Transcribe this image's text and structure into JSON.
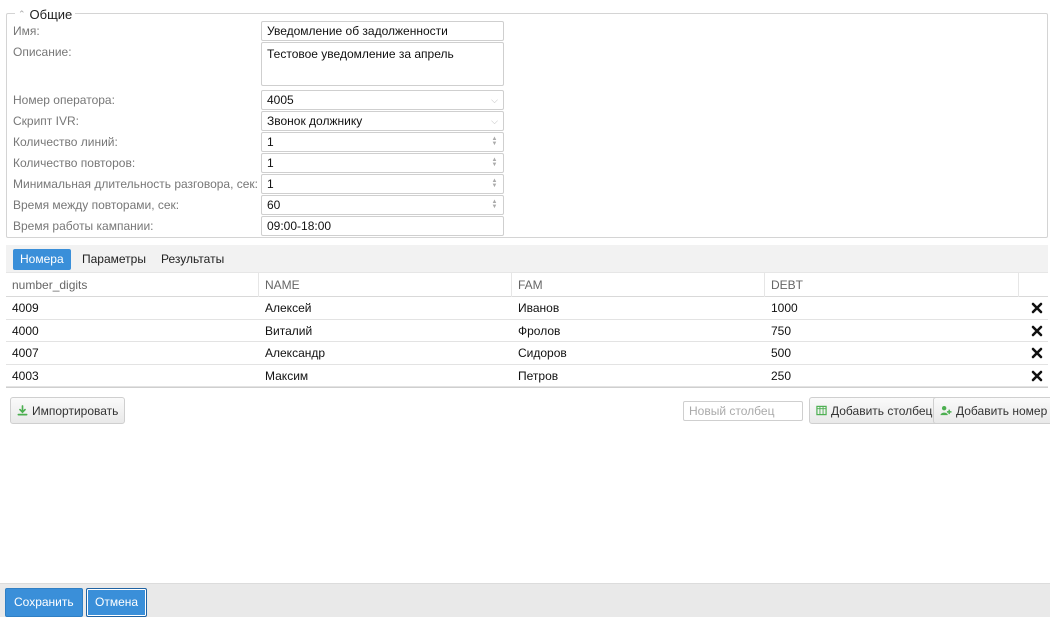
{
  "general": {
    "legend": "Общие",
    "fields": [
      {
        "label": "Имя:",
        "value": "Уведомление об задолженности",
        "type": "text"
      },
      {
        "label": "Описание:",
        "value": "Тестовое уведомление за апрель",
        "type": "textarea"
      },
      {
        "label": "Номер оператора:",
        "value": "4005",
        "type": "select"
      },
      {
        "label": "Скрипт IVR:",
        "value": "Звонок должнику",
        "type": "select"
      },
      {
        "label": "Количество линий:",
        "value": "1",
        "type": "number"
      },
      {
        "label": "Количество повторов:",
        "value": "1",
        "type": "number"
      },
      {
        "label": "Минимальная длительность разговора, сек:",
        "value": "1",
        "type": "number"
      },
      {
        "label": "Время между повторами, сек:",
        "value": "60",
        "type": "number"
      },
      {
        "label": "Время работы кампании:",
        "value": "09:00-18:00",
        "type": "text"
      }
    ]
  },
  "tabs": [
    {
      "label": "Номера",
      "active": true
    },
    {
      "label": "Параметры",
      "active": false
    },
    {
      "label": "Результаты",
      "active": false
    }
  ],
  "table": {
    "columns": [
      "number_digits",
      "NAME",
      "FAM",
      "DEBT"
    ],
    "rows": [
      [
        "4009",
        "Алексей",
        "Иванов",
        "1000"
      ],
      [
        "4000",
        "Виталий",
        "Фролов",
        "750"
      ],
      [
        "4007",
        "Александр",
        "Сидоров",
        "500"
      ],
      [
        "4003",
        "Максим",
        "Петров",
        "250"
      ]
    ]
  },
  "actions": {
    "import_label": "Импортировать",
    "new_column_placeholder": "Новый столбец",
    "add_column_label": "Добавить столбец",
    "add_number_label": "Добавить номер"
  },
  "footer": {
    "save_label": "Сохранить",
    "cancel_label": "Отмена"
  },
  "colors": {
    "accent": "#3a8fd9",
    "footer_bg": "#e9e9e9",
    "tabbar_bg": "#f2f2f2",
    "import_icon": "#4caf50",
    "add_column_icon": "#4caf50",
    "add_number_icon": "#4caf50"
  },
  "icons": {
    "legend": "chevron-up-icon",
    "select": "chevron-down-icon",
    "number": "spinner-arrows-icon",
    "delete": "close-icon",
    "import": "download-icon",
    "add_column": "add-column-icon",
    "add_number": "add-user-icon"
  }
}
